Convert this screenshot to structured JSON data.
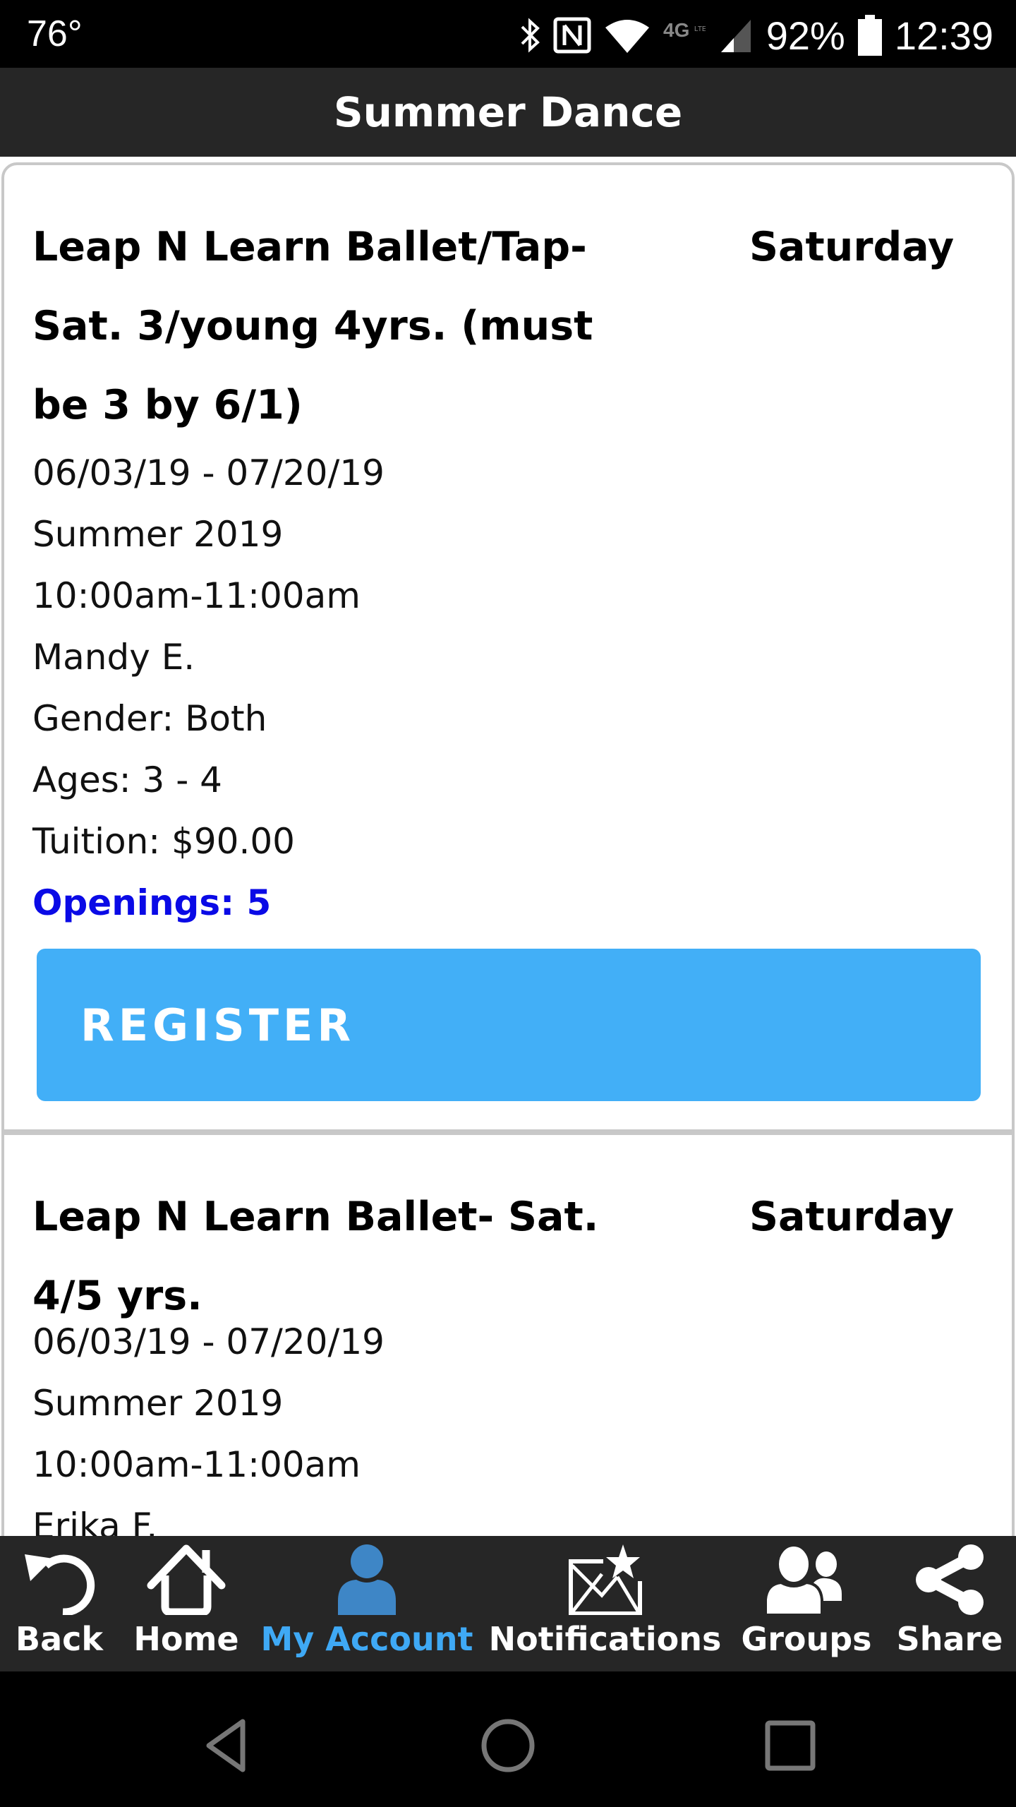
{
  "status_bar": {
    "temperature": "76°",
    "icons": [
      "bluetooth-icon",
      "nfc-icon",
      "wifi-icon",
      "4g-lte-icon",
      "cell-signal-icon",
      "battery-icon"
    ],
    "battery": "92%",
    "time": "12:39"
  },
  "header": {
    "title": "Summer Dance"
  },
  "classes": [
    {
      "title": "Leap N Learn Ballet/Tap-Sat. 3/young 4yrs. (must be 3 by 6/1)",
      "day": "Saturday",
      "dates": "06/03/19 - 07/20/19",
      "session": "Summer 2019",
      "time": "10:00am-11:00am",
      "instructor": "Mandy E.",
      "gender": "Gender: Both",
      "ages": "Ages: 3 - 4",
      "tuition": "Tuition: $90.00",
      "openings": "Openings: 5",
      "register_label": "REGISTER"
    },
    {
      "title": "Leap N Learn Ballet- Sat. 4/5 yrs.",
      "day": "Saturday",
      "dates": "06/03/19 - 07/20/19",
      "session": "Summer 2019",
      "time": "10:00am-11:00am",
      "instructor": "Erika F."
    }
  ],
  "bottom_nav": {
    "items": [
      {
        "label": "Back",
        "icon": "back-arrow-icon"
      },
      {
        "label": "Home",
        "icon": "home-icon"
      },
      {
        "label": "My Account",
        "icon": "user-icon",
        "active": true
      },
      {
        "label": "Notifications",
        "icon": "mail-star-icon"
      },
      {
        "label": "Groups",
        "icon": "groups-icon"
      },
      {
        "label": "Share",
        "icon": "share-icon"
      }
    ]
  },
  "colors": {
    "header_bg": "#262626",
    "register_button": "#42aff7",
    "openings_text": "#0a0ae6",
    "active_nav": "#3fa9f5"
  }
}
